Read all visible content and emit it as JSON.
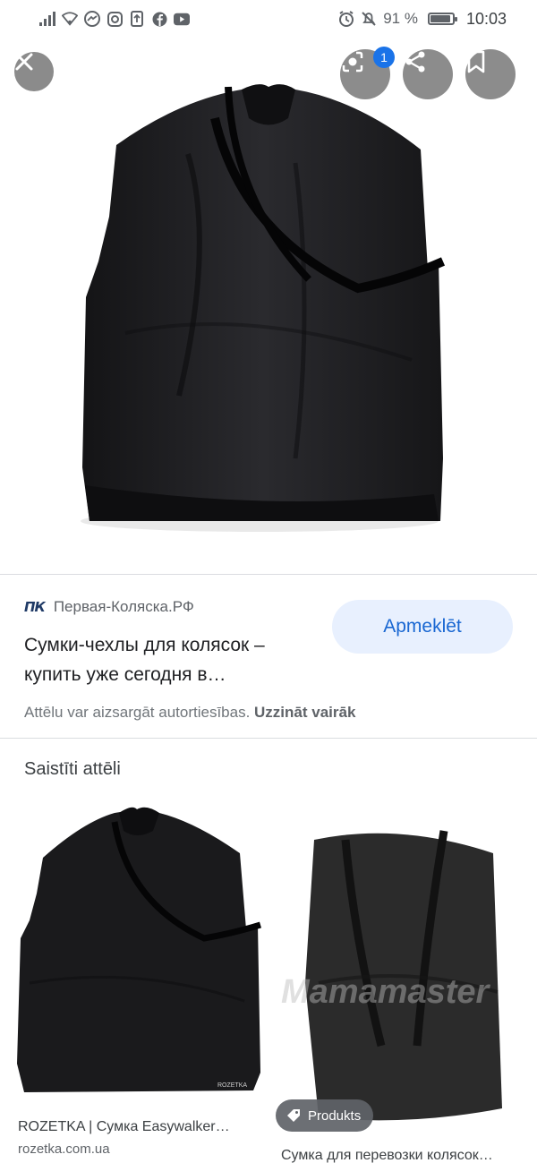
{
  "status_bar": {
    "battery": "91 %",
    "battery_level": 0.91,
    "time": "10:03"
  },
  "viewer": {
    "lens_badge": "1"
  },
  "source": {
    "logo": "ПК",
    "name": "Первая-Коляска.РФ"
  },
  "result": {
    "title": "Сумки-чехлы для колясок – купить уже сегодня в…",
    "visit_label": "Apmeklēt",
    "copyright_text": "Attēlu var aizsargāt autortiesības.",
    "learn_more": "Uzzināt vairāk"
  },
  "related": {
    "heading": "Saistīti attēli",
    "items": [
      {
        "caption": "ROZETKA | Сумка Easywalker…",
        "domain": "rozetka.com.ua",
        "brand_mark": "ROZETKA"
      },
      {
        "caption": "Сумка для перевозки колясок…",
        "chip": "Produkts",
        "watermark": "Mamamaster"
      }
    ]
  },
  "colors": {
    "accent": "#1a73e8",
    "visit_bg": "#e8f0fe",
    "visit_text": "#1967d2",
    "bag": "#1c1c1e"
  }
}
